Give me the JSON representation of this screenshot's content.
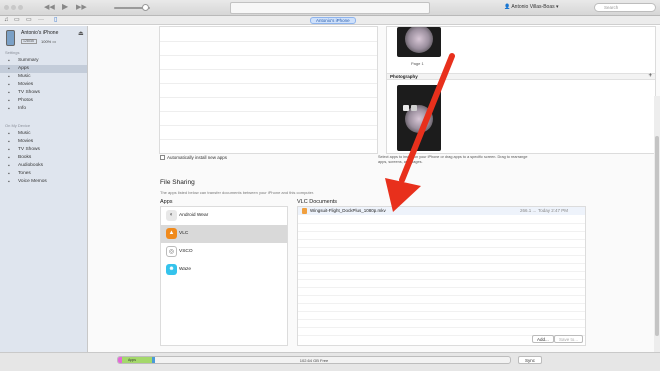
{
  "toolbar": {
    "account_name": "Antonio Villas-Boas",
    "search_placeholder": "Search",
    "device_pill": "Antonio's iPhone"
  },
  "device": {
    "name": "Antonio's iPhone",
    "capacity": "128GB",
    "battery": "100%"
  },
  "sidebar": {
    "settings_header": "Settings",
    "settings_items": [
      {
        "label": "Summary",
        "icon": "summary-icon"
      },
      {
        "label": "Apps",
        "icon": "apps-icon"
      },
      {
        "label": "Music",
        "icon": "music-icon"
      },
      {
        "label": "Movies",
        "icon": "movies-icon"
      },
      {
        "label": "TV Shows",
        "icon": "tv-icon"
      },
      {
        "label": "Photos",
        "icon": "photos-icon"
      },
      {
        "label": "Info",
        "icon": "info-icon"
      }
    ],
    "device_header": "On My Device",
    "device_items": [
      {
        "label": "Music",
        "icon": "music-icon"
      },
      {
        "label": "Movies",
        "icon": "movies-icon"
      },
      {
        "label": "TV Shows",
        "icon": "tv-icon"
      },
      {
        "label": "Books",
        "icon": "books-icon"
      },
      {
        "label": "Audiobooks",
        "icon": "audiobooks-icon"
      },
      {
        "label": "Tones",
        "icon": "tones-icon"
      },
      {
        "label": "Voice Memos",
        "icon": "voice-memos-icon"
      }
    ]
  },
  "home_screens": {
    "page_label": "Page 1",
    "group_label": "Photography"
  },
  "auto_install_label": "Automatically install new apps",
  "hint_text": "Select apps to install on your iPhone or drag apps to a specific screen. Drag to rearrange apps, screens, and pages.",
  "file_sharing": {
    "title": "File Sharing",
    "description": "The apps listed below can transfer documents between your iPhone and this computer.",
    "apps_header": "Apps",
    "docs_header": "VLC Documents",
    "apps": [
      {
        "name": "Android Wear",
        "color": "#e8e8e8",
        "glyph": "◐",
        "selected": false
      },
      {
        "name": "VLC",
        "color": "#f08a1c",
        "glyph": "▲",
        "selected": true
      },
      {
        "name": "VSCO",
        "color": "#ffffff",
        "glyph": "◎",
        "selected": false
      },
      {
        "name": "Waze",
        "color": "#35c3ec",
        "glyph": "☻",
        "selected": false
      }
    ],
    "documents": [
      {
        "name": "Wingsuit-Flight_DockPlus_1080p.mkv",
        "size": "266.1 ...",
        "date": "Today 2:47 PM"
      }
    ],
    "add_button": "Add...",
    "save_button": "Save to..."
  },
  "storage": {
    "apps_label": "Apps",
    "free_label": "102.64 GB Free",
    "sync_button": "Sync"
  },
  "colors": {
    "annotation_arrow": "#e8301c",
    "selection": "#c3ccd9"
  }
}
